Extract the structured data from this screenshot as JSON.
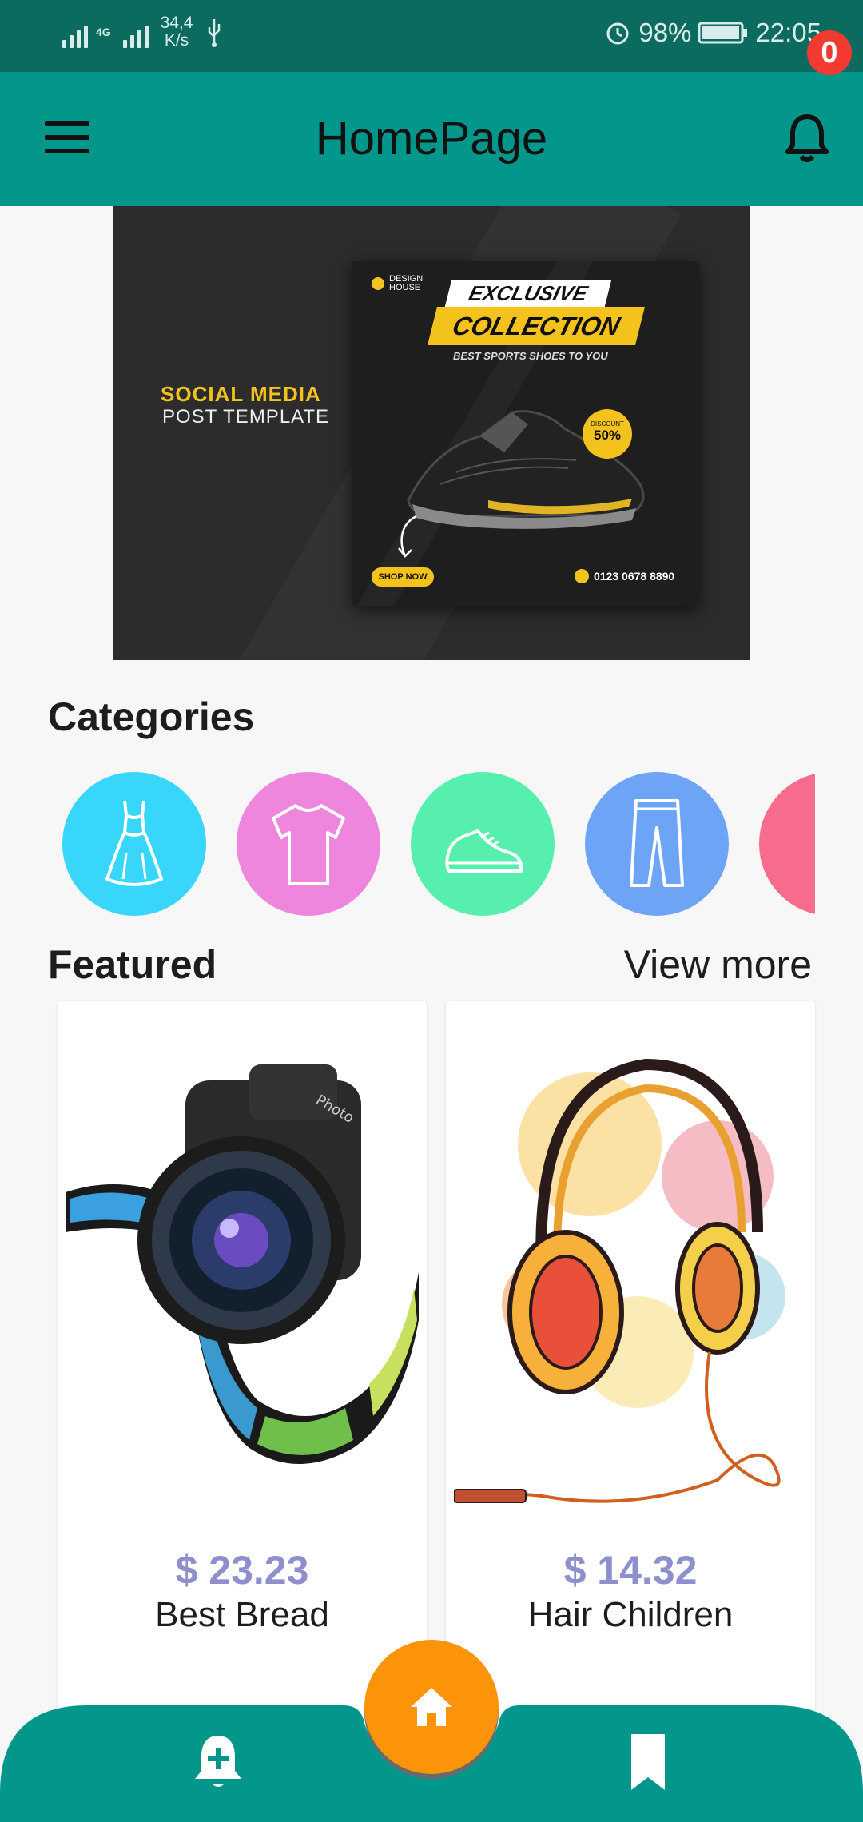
{
  "status_bar": {
    "net_speed_value": "34,4",
    "net_speed_unit": "K/s",
    "network_type": "4G",
    "battery": "98%",
    "time": "22:05"
  },
  "app_bar": {
    "title": "HomePage",
    "notification_count": "0"
  },
  "banner": {
    "line1": "SOCIAL MEDIA",
    "line2": "POST TEMPLATE",
    "brand": "DESIGN HOUSE",
    "badge_top": "EXCLUSIVE",
    "badge_main": "COLLECTION",
    "tagline": "BEST SPORTS SHOES TO YOU",
    "discount_label": "DISCOUNT",
    "discount_value": "50%",
    "cta": "SHOP NOW",
    "phone": "0123 0678 8890"
  },
  "categories": {
    "title": "Categories",
    "items": [
      {
        "icon": "dress-icon",
        "color": "#38d6fb"
      },
      {
        "icon": "tshirt-icon",
        "color": "#ee86de"
      },
      {
        "icon": "sneaker-icon",
        "color": "#56efad"
      },
      {
        "icon": "pants-icon",
        "color": "#6ea4f5"
      },
      {
        "icon": "tag-icon",
        "color": "#f76b8c"
      }
    ]
  },
  "featured": {
    "title": "Featured",
    "view_more": "View more",
    "products": [
      {
        "price": "$ 23.23",
        "name": "Best Bread",
        "image": "camera-image"
      },
      {
        "price": "$ 14.32",
        "name": "Hair Children",
        "image": "headphones-image"
      }
    ]
  },
  "bottom_nav": {
    "color": "#03968a",
    "fab_color": "#fb9408",
    "items": [
      "add-alert-icon",
      "home-icon",
      "bookmark-icon"
    ]
  }
}
